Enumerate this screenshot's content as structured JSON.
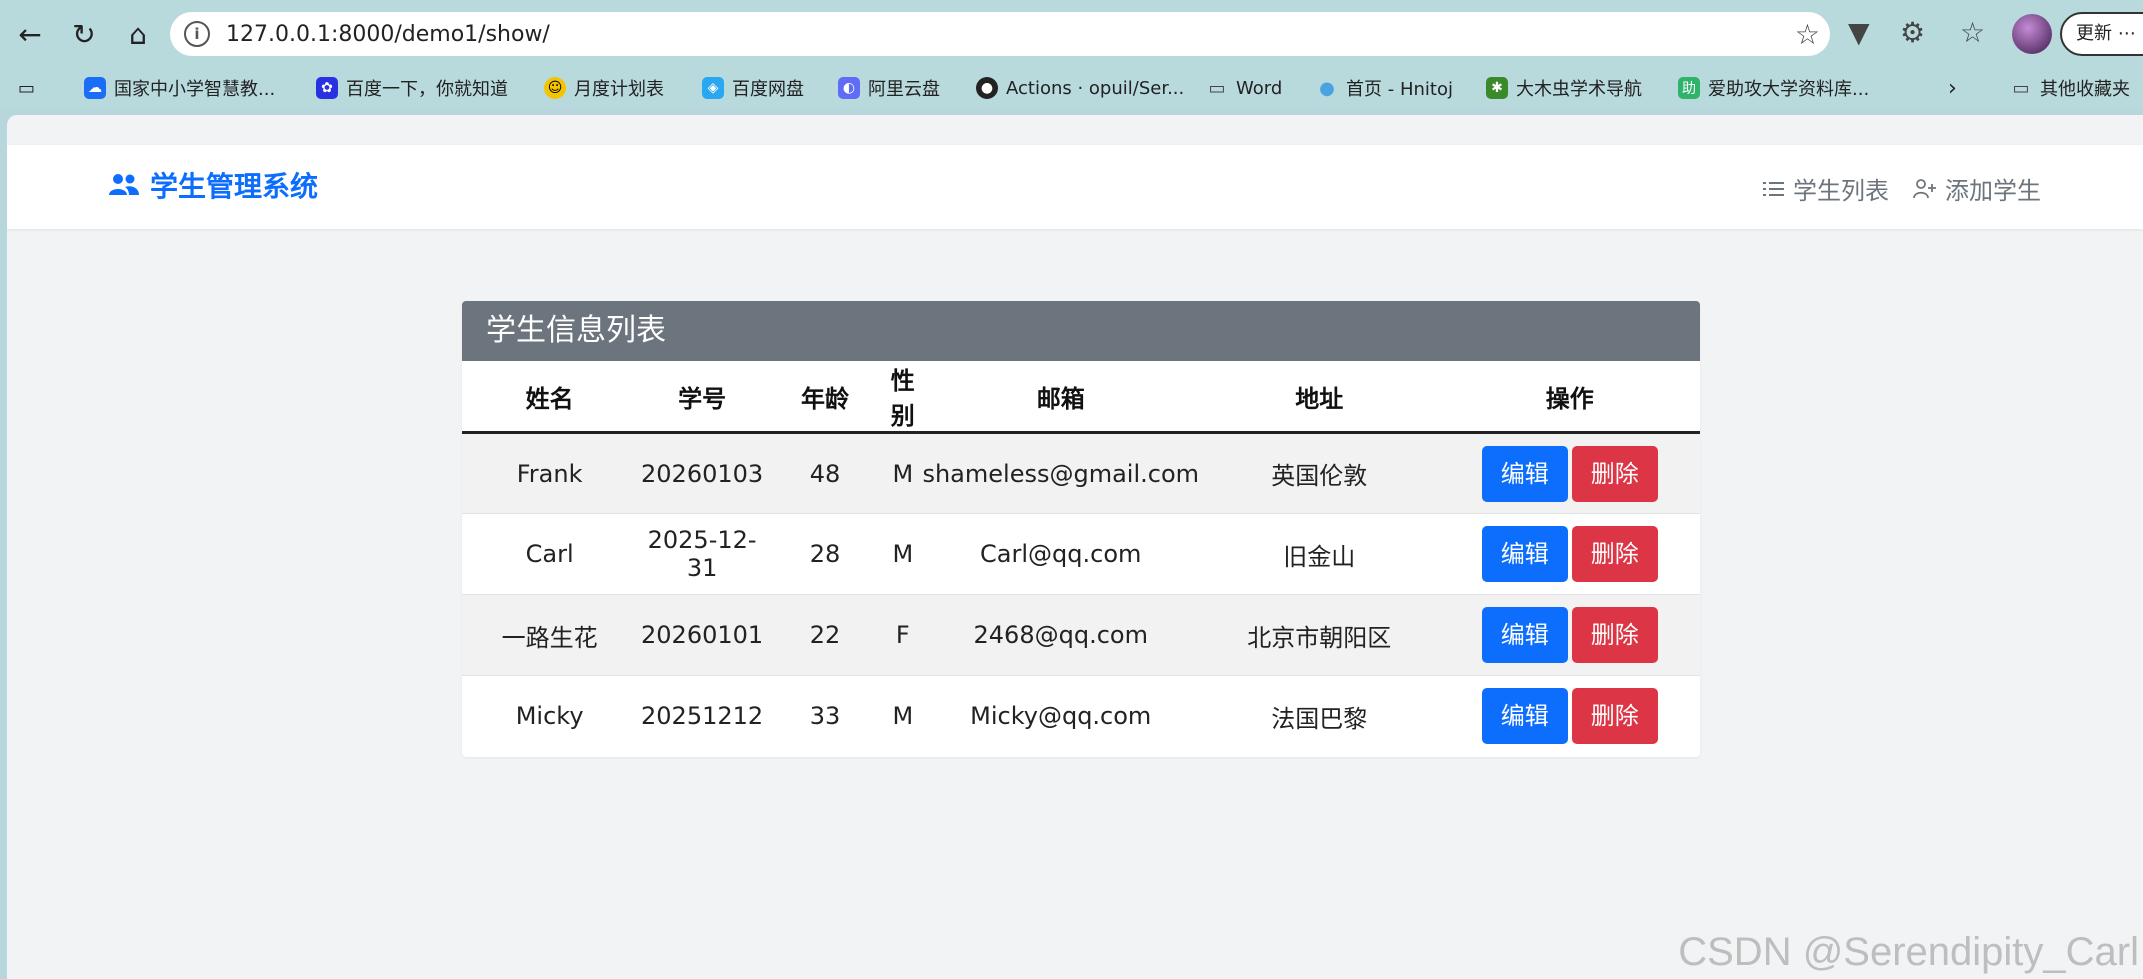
{
  "browser": {
    "url": "127.0.0.1:8000/demo1/show/",
    "update_label": "更新 ⋯",
    "bookmarks": [
      {
        "label": "国家中小学智慧教...",
        "icon": "cloud-icon",
        "color": "#1a6ef5"
      },
      {
        "label": "百度一下，你就知道",
        "icon": "baidu-icon",
        "color": "#2932e1"
      },
      {
        "label": "月度计划表",
        "icon": "smiley-icon",
        "color": "#f5c400"
      },
      {
        "label": "百度网盘",
        "icon": "baidu-netdisk-icon",
        "color": "#2aa7f1"
      },
      {
        "label": "阿里云盘",
        "icon": "aliyun-drive-icon",
        "color": "#5f6cf6"
      },
      {
        "label": "Actions · opuil/Ser...",
        "icon": "github-icon",
        "color": "#222222"
      },
      {
        "label": "Word",
        "icon": "folder-icon",
        "color": "#444444"
      },
      {
        "label": "首页 - Hnitoj",
        "icon": "water-drop-icon",
        "color": "#4aa3e0"
      },
      {
        "label": "大木虫学术导航",
        "icon": "bug-icon",
        "color": "#3a8a2a"
      },
      {
        "label": "爱助攻大学资料库...",
        "icon": "help-icon",
        "color": "#2fb36a"
      },
      {
        "label": "其他收藏夹",
        "icon": "folder-icon",
        "color": "#444444"
      }
    ]
  },
  "app": {
    "brand": "学生管理系统",
    "nav": {
      "list_label": "学生列表",
      "add_label": "添加学生"
    },
    "colors": {
      "primary": "#0d6efd",
      "danger": "#dc3545",
      "header": "#6c757d"
    }
  },
  "table": {
    "title": "学生信息列表",
    "headers": [
      "姓名",
      "学号",
      "年龄",
      "性别",
      "邮箱",
      "地址",
      "操作"
    ],
    "rows": [
      {
        "name": "Frank",
        "id": "20260103",
        "age": "48",
        "gender": "M",
        "email": "shameless@gmail.com",
        "address": "英国伦敦"
      },
      {
        "name": "Carl",
        "id": "2025-12-31",
        "age": "28",
        "gender": "M",
        "email": "Carl@qq.com",
        "address": "旧金山"
      },
      {
        "name": "一路生花",
        "id": "20260101",
        "age": "22",
        "gender": "F",
        "email": "2468@qq.com",
        "address": "北京市朝阳区"
      },
      {
        "name": "Micky",
        "id": "20251212",
        "age": "33",
        "gender": "M",
        "email": "Micky@qq.com",
        "address": "法国巴黎"
      }
    ],
    "edit_label": "编辑",
    "delete_label": "删除"
  },
  "watermark": "CSDN @Serendipity_Carl"
}
